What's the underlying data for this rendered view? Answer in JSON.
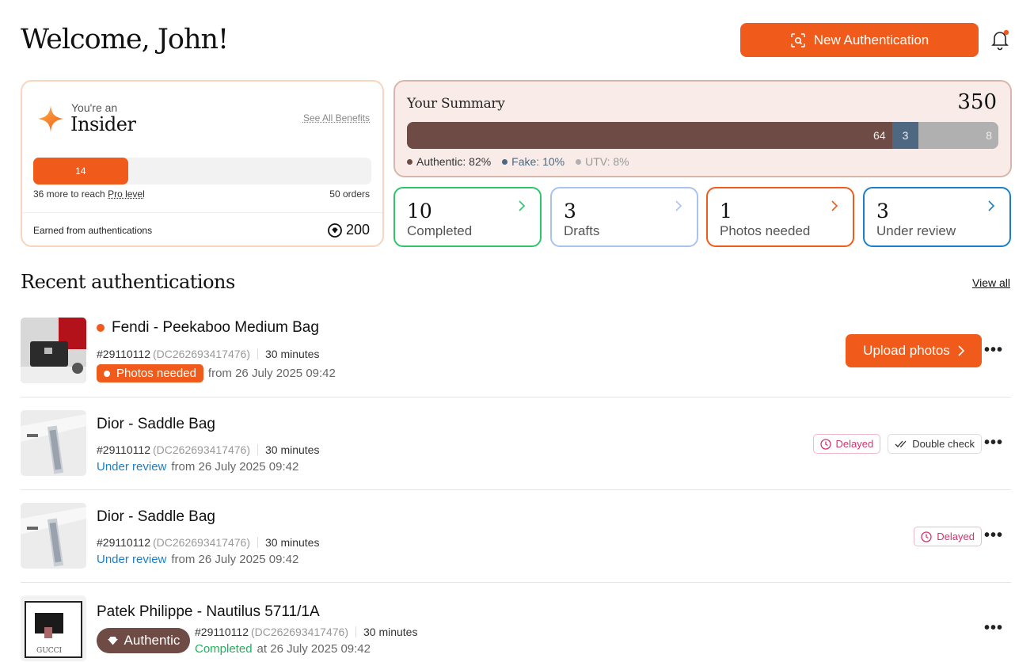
{
  "header": {
    "title": "Welcome, John!",
    "new_auth_label": "New Authentication"
  },
  "insider": {
    "small": "You're an",
    "tier": "Insider",
    "benefits_link": "See All Benefits",
    "progress_value": 14,
    "progress_target": 50,
    "reach_prefix": "36 more to reach ",
    "reach_link": "Pro level",
    "orders": "50 orders",
    "earned_label": "Earned from authentications",
    "points": "200"
  },
  "summary": {
    "label": "Your Summary",
    "total": "350",
    "segments": [
      {
        "name": "Authentic",
        "count": "64",
        "percent": 82,
        "color": "#6e4b45"
      },
      {
        "name": "Fake",
        "count": "3",
        "percent": 10,
        "color": "#4d6880"
      },
      {
        "name": "UTV",
        "count": "8",
        "percent": 8,
        "color": "#b0b0b0"
      }
    ],
    "legend": {
      "authentic": "Authentic: 82%",
      "fake": "Fake: 10%",
      "utv": "UTV: 8%"
    }
  },
  "stats": [
    {
      "num": "10",
      "label": "Completed",
      "color": "#2fc46b"
    },
    {
      "num": "3",
      "label": "Drafts",
      "color": "#a9c3f0"
    },
    {
      "num": "1",
      "label": "Photos needed",
      "color": "#f05a1a"
    },
    {
      "num": "3",
      "label": "Under review",
      "color": "#1a7fc4"
    }
  ],
  "recent": {
    "title": "Recent authentications",
    "view_all": "View all",
    "rows": [
      {
        "name": "Fendi - Peekaboo Medium Bag",
        "order": "#29110112",
        "dc": "(DC262693417476)",
        "time": "30 minutes",
        "status": "Photos needed",
        "from": "from 26 July 2025 09:42",
        "action": "Upload photos"
      },
      {
        "name": "Dior - Saddle Bag",
        "order": "#29110112",
        "dc": "(DC262693417476)",
        "time": "30 minutes",
        "status": "Under review",
        "from": "from 26 July 2025 09:42",
        "tags": [
          "Delayed",
          "Double check"
        ]
      },
      {
        "name": "Dior - Saddle Bag",
        "order": "#29110112",
        "dc": "(DC262693417476)",
        "time": "30 minutes",
        "status": "Under review",
        "from": "from 26 July 2025 09:42",
        "tags": [
          "Delayed"
        ]
      },
      {
        "name": "Patek Philippe - Nautilus 5711/1A",
        "badge": "Authentic",
        "order": "#29110112",
        "dc": "(DC262693417476)",
        "time": "30 minutes",
        "status": "Completed",
        "from": "at 26 July 2025 09:42"
      }
    ]
  },
  "more_label": "•••"
}
